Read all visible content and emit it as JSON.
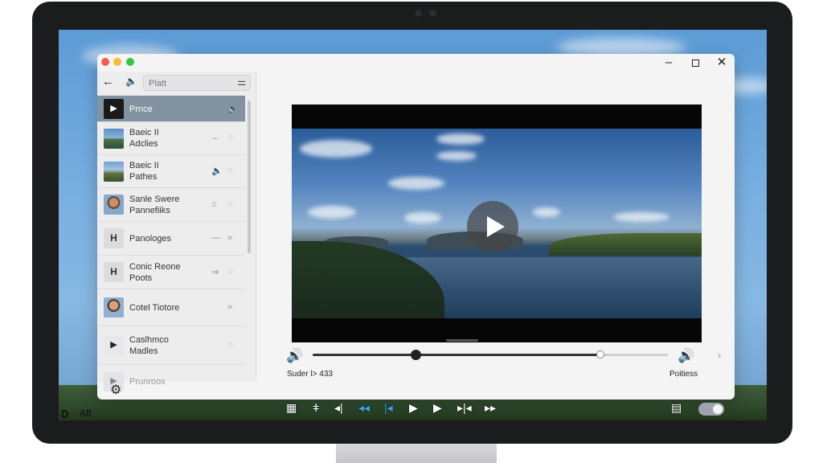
{
  "desktop": {
    "label": "Aft"
  },
  "window": {
    "minimize": "–",
    "close": "✕"
  },
  "sidebar": {
    "search_placeholder": "Platt",
    "items": [
      {
        "label": "Prnce",
        "icon1": "",
        "icon2": "🔈",
        "thumb": "play"
      },
      {
        "label": "Baeic II\nAdclies",
        "icon1": "←",
        "icon2": "◌",
        "thumb": "photo"
      },
      {
        "label": "Baeic II\nPathes",
        "icon1": "🔈",
        "icon2": "◌",
        "thumb": "photo"
      },
      {
        "label": "Sanle Swere\nPannefiiks",
        "icon1": "⌂",
        "icon2": "◌",
        "thumb": "face"
      },
      {
        "label": "Panologes",
        "icon1": "—",
        "icon2": "»",
        "thumb": "letter"
      },
      {
        "label": "Conic Reone\nPoots",
        "icon1": "⇒",
        "icon2": "◌",
        "thumb": "letter"
      },
      {
        "label": "Cotel Tiotore",
        "icon1": "",
        "icon2": "»",
        "thumb": "face"
      },
      {
        "label": "Caslhmco\nMadles",
        "icon1": "",
        "icon2": "◌",
        "thumb": "play"
      },
      {
        "label": "Prunroos",
        "icon1": "",
        "icon2": "",
        "thumb": "play-light"
      }
    ]
  },
  "player": {
    "time_text": "Suder l> 433",
    "quality_text": "Poitiess",
    "progress": 0.29,
    "buffered": 0.81
  },
  "colors": {
    "accent_blue": "#39a3e6",
    "active_row": "#8292a1"
  }
}
